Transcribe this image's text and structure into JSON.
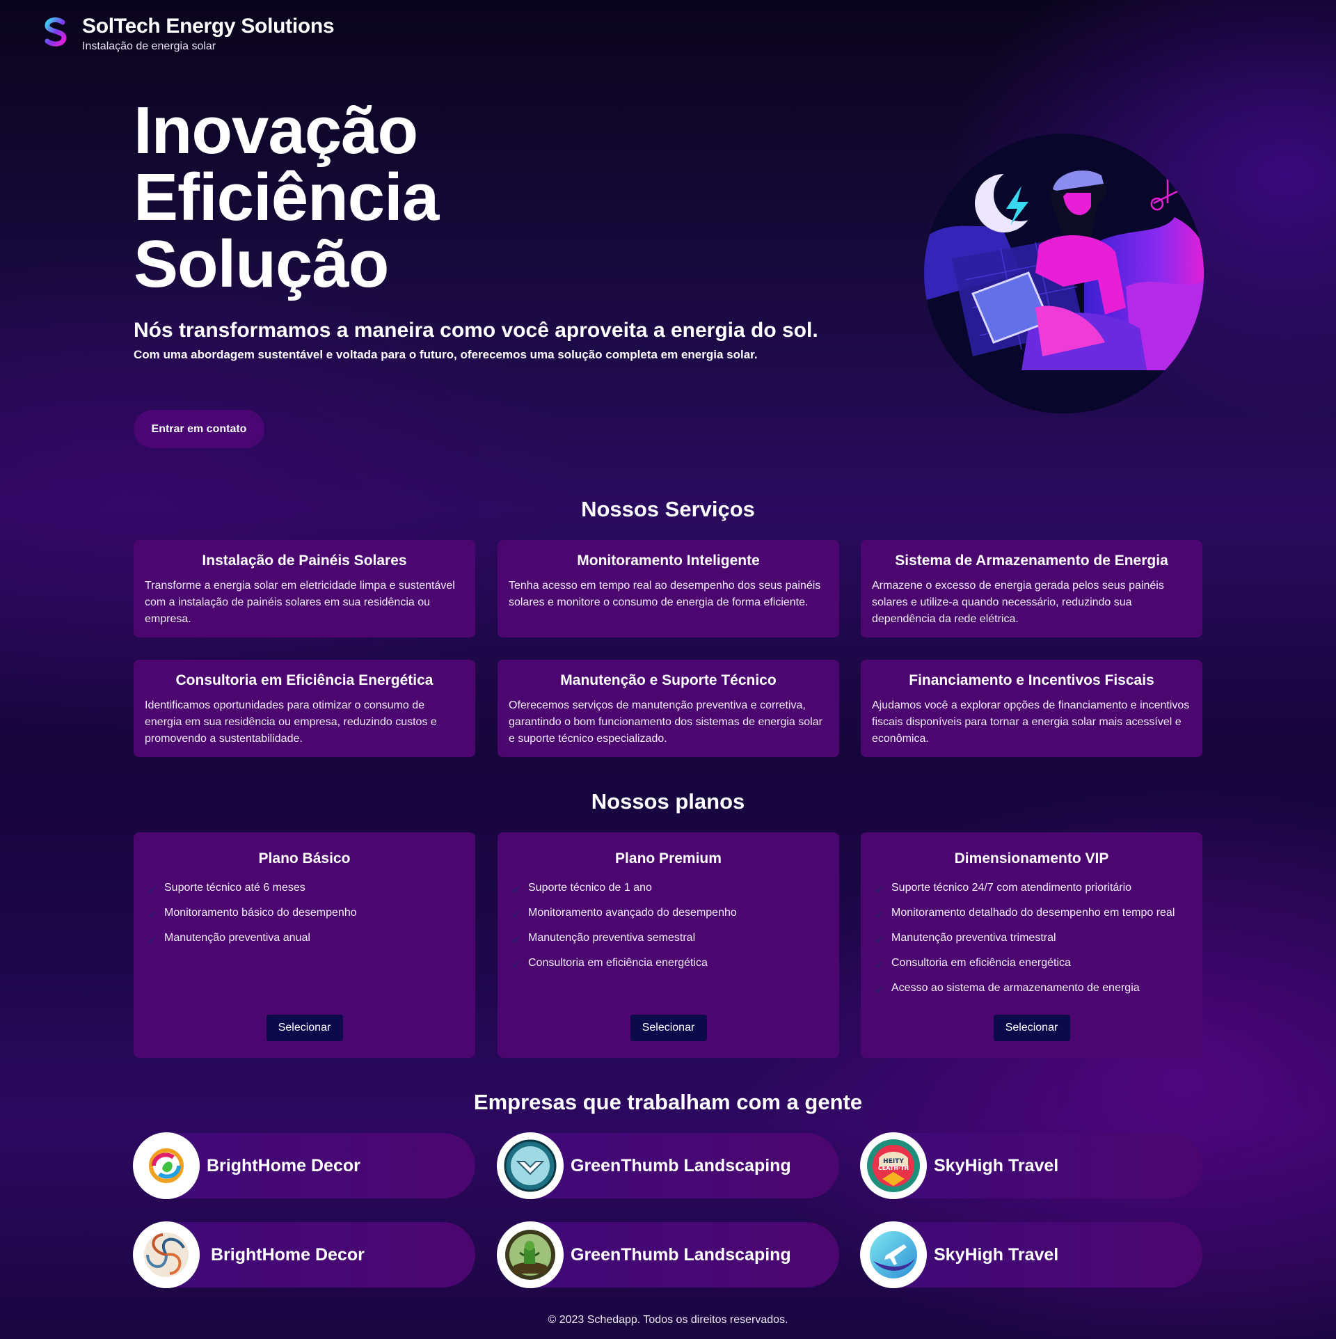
{
  "header": {
    "brand": "SolTech Energy Solutions",
    "tagline": "Instalação de energia solar"
  },
  "hero": {
    "title_lines": [
      "Inovação",
      "Eficiência",
      "Solução"
    ],
    "lead": "Nós transformamos a maneira como você aproveita a energia do sol.",
    "description": "Com uma abordagem sustentável e voltada para o futuro, oferecemos uma solução completa em energia solar.",
    "cta_label": "Entrar em contato"
  },
  "services": {
    "title": "Nossos Serviços",
    "items": [
      {
        "title": "Instalação de Painéis Solares",
        "text": "Transforme a energia solar em eletricidade limpa e sustentável com a instalação de painéis solares em sua residência ou empresa."
      },
      {
        "title": "Monitoramento Inteligente",
        "text": "Tenha acesso em tempo real ao desempenho dos seus painéis solares e monitore o consumo de energia de forma eficiente."
      },
      {
        "title": "Sistema de Armazenamento de Energia",
        "text": "Armazene o excesso de energia gerada pelos seus painéis solares e utilize-a quando necessário, reduzindo sua dependência da rede elétrica."
      },
      {
        "title": "Consultoria em Eficiência Energética",
        "text": "Identificamos oportunidades para otimizar o consumo de energia em sua residência ou empresa, reduzindo custos e promovendo a sustentabilidade."
      },
      {
        "title": "Manutenção e Suporte Técnico",
        "text": "Oferecemos serviços de manutenção preventiva e corretiva, garantindo o bom funcionamento dos sistemas de energia solar e suporte técnico especializado."
      },
      {
        "title": "Financiamento e Incentivos Fiscais",
        "text": "Ajudamos você a explorar opções de financiamento e incentivos fiscais disponíveis para tornar a energia solar mais acessível e econômica."
      }
    ]
  },
  "plans": {
    "title": "Nossos planos",
    "select_label": "Selecionar",
    "items": [
      {
        "title": "Plano Básico",
        "features": [
          "Suporte técnico até 6 meses",
          "Monitoramento básico do desempenho",
          "Manutenção preventiva anual"
        ]
      },
      {
        "title": "Plano Premium",
        "features": [
          "Suporte técnico de 1 ano",
          "Monitoramento avançado do desempenho",
          "Manutenção preventiva semestral",
          "Consultoria em eficiência energética"
        ]
      },
      {
        "title": "Dimensionamento VIP",
        "features": [
          "Suporte técnico 24/7 com atendimento prioritário",
          "Monitoramento detalhado do desempenho em tempo real",
          "Manutenção preventiva trimestral",
          "Consultoria em eficiência energética",
          "Acesso ao sistema de armazenamento de energia"
        ]
      }
    ]
  },
  "partners": {
    "title": "Empresas que trabalham com a gente",
    "items": [
      {
        "name": "BrightHome Decor",
        "logo": "swirl-leaf-logo"
      },
      {
        "name": "GreenThumb Landscaping",
        "logo": "glass-emblem-logo"
      },
      {
        "name": "SkyHigh Travel",
        "logo": "healthy-badge-logo",
        "logo_text": "HEALTHY CEATH·TH"
      },
      {
        "name": "BrightHome Decor",
        "logo": "fan-swirl-logo"
      },
      {
        "name": "GreenThumb Landscaping",
        "logo": "plant-figure-logo"
      },
      {
        "name": "SkyHigh Travel",
        "logo": "airplane-logo"
      }
    ]
  },
  "footer": {
    "text": "© 2023 Schedapp. Todos os direitos reservados."
  },
  "colors": {
    "card": "#4c0670",
    "button_dark": "#0d0a4c",
    "cta": "#4a0672",
    "accent_pink": "#e81fd6",
    "accent_cyan": "#3ad8f0"
  }
}
